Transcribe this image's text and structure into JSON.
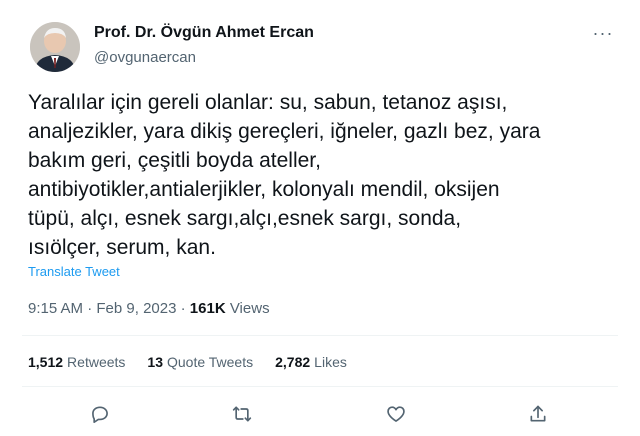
{
  "author": {
    "display_name": "Prof. Dr. Övgün Ahmet Ercan",
    "handle": "@ovgunaercan",
    "avatar_icon": "person-avatar"
  },
  "tweet": {
    "text": "Yaralılar için gereli olanlar: su, sabun, tetanoz aşısı,\nanaljezikler, yara dikiş gereçleri, iğneler, gazlı bez, yara\nbakım geri, çeşitli boyda ateller,\nantibiyotikler,antialerjikler, kolonyalı mendil, oksijen\ntüpü, alçı, esnek sargı,alçı,esnek sargı, sonda,\nısıölçer, serum, kan.",
    "translate_label": "Translate Tweet",
    "time": "9:15 AM",
    "separator": "·",
    "date": "Feb 9, 2023",
    "views_count": "161K",
    "views_label": "Views"
  },
  "stats": {
    "retweets_count": "1,512",
    "retweets_label": "Retweets",
    "quotes_count": "13",
    "quotes_label": "Quote Tweets",
    "likes_count": "2,782",
    "likes_label": "Likes"
  },
  "more_label": "···",
  "colors": {
    "text_primary": "#0f1419",
    "text_secondary": "#536471",
    "accent": "#1d9bf0",
    "divider": "#eff3f4"
  },
  "icons": [
    "more-icon",
    "reply-icon",
    "retweet-icon",
    "like-icon",
    "share-icon"
  ]
}
